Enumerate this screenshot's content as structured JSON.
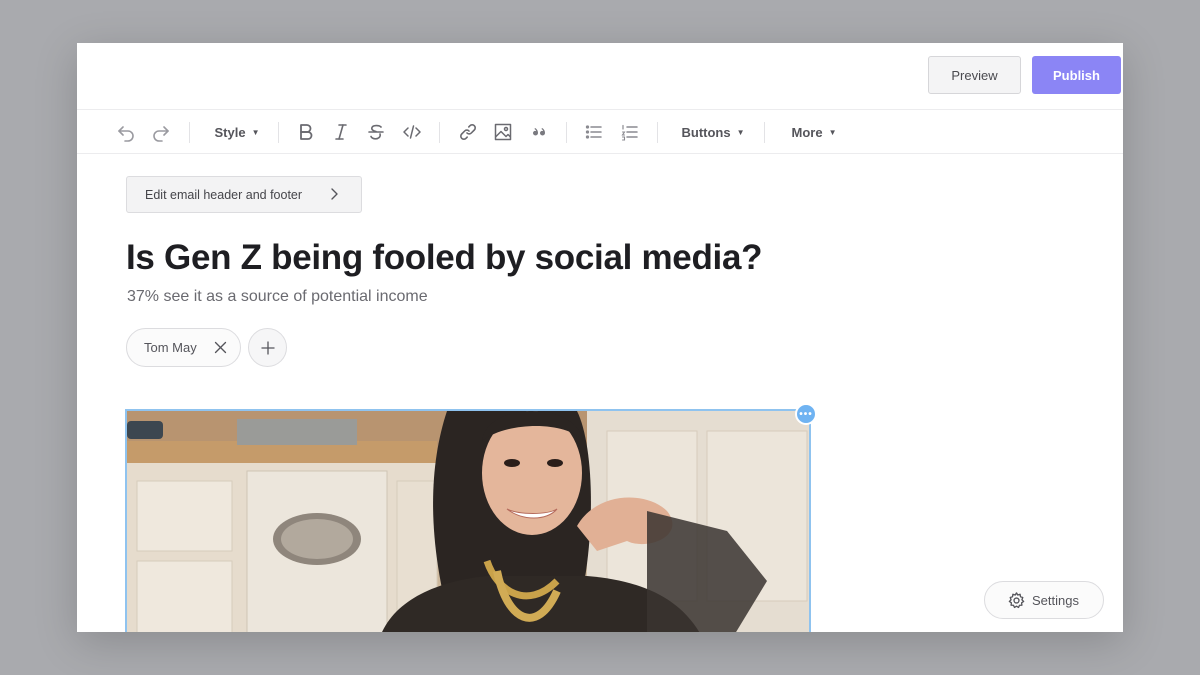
{
  "topbar": {
    "preview_label": "Preview",
    "publish_label": "Publish"
  },
  "toolbar": {
    "style_label": "Style",
    "buttons_label": "Buttons",
    "more_label": "More",
    "icons": [
      "undo-icon",
      "redo-icon",
      "bold-icon",
      "italic-icon",
      "strikethrough-icon",
      "code-icon",
      "link-icon",
      "image-icon",
      "quote-icon",
      "bullet-list-icon",
      "numbered-list-icon"
    ]
  },
  "editor": {
    "header_footer_label": "Edit email header and footer",
    "title": "Is Gen Z being fooled by social media?",
    "subtitle": "37% see it as a source of potential income",
    "authors": [
      {
        "name": "Tom May"
      }
    ],
    "image_handle": "•••"
  },
  "settings_label": "Settings",
  "colors": {
    "accent": "#8b85f5",
    "selection": "#8fc3ef"
  }
}
